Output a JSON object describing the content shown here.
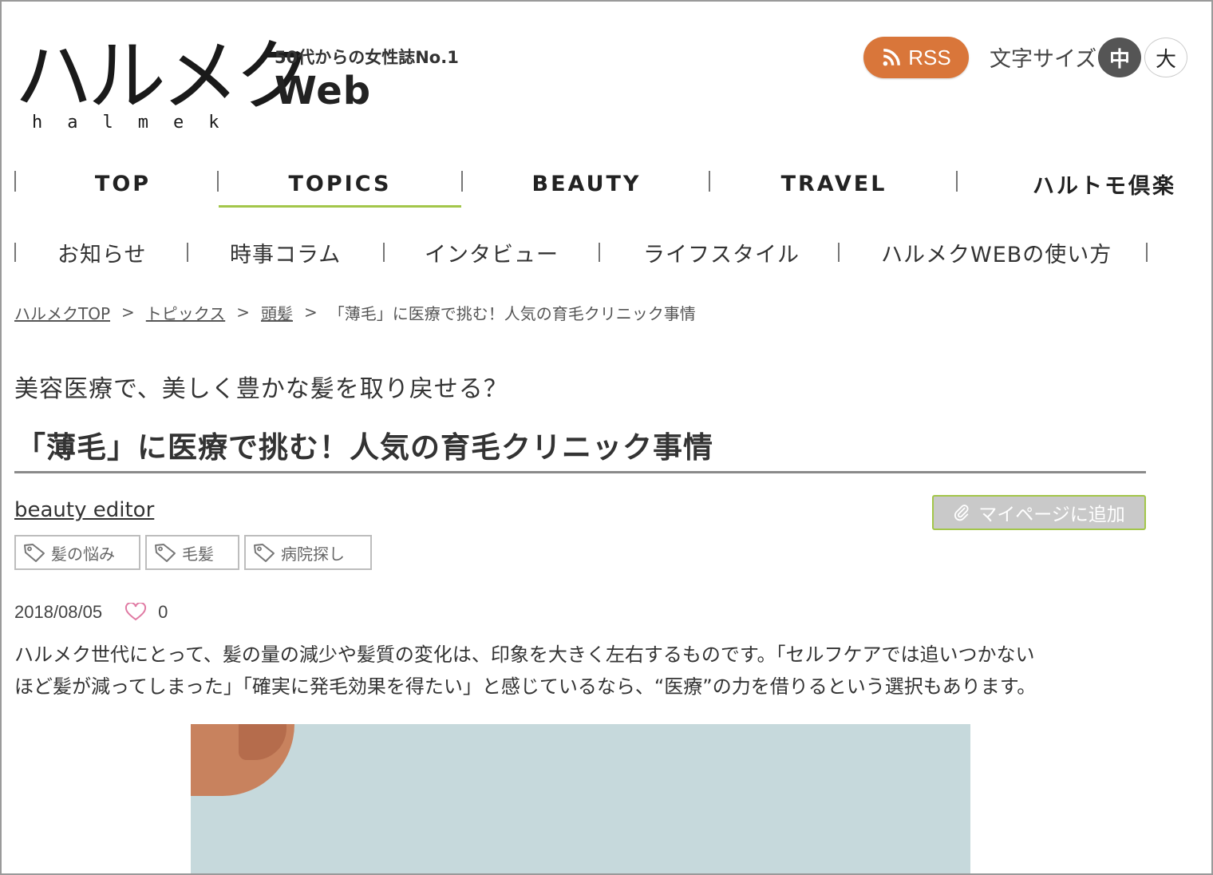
{
  "header": {
    "logo_main": "ハルメク",
    "logo_roman": "halmek",
    "tagline": "50代からの女性誌No.1",
    "logo_web": "Web",
    "rss_label": "RSS",
    "rss_color": "#d9763a",
    "font_size_label": "文字サイズ",
    "font_size_options": [
      {
        "label": "中",
        "selected": true
      },
      {
        "label": "大",
        "selected": false
      }
    ]
  },
  "global_nav": {
    "active_color": "#a3c64a",
    "items": [
      {
        "label": "TOP"
      },
      {
        "label": "TOPICS",
        "active": true
      },
      {
        "label": "BEAUTY"
      },
      {
        "label": "TRAVEL"
      },
      {
        "label": "ハルトモ倶楽"
      }
    ]
  },
  "sub_nav": {
    "items": [
      {
        "label": "お知らせ"
      },
      {
        "label": "時事コラム"
      },
      {
        "label": "インタビュー"
      },
      {
        "label": "ライフスタイル"
      },
      {
        "label": "ハルメクWEBの使い方"
      }
    ]
  },
  "breadcrumb": {
    "items": [
      {
        "label": "ハルメクTOP",
        "link": true
      },
      {
        "label": "トピックス",
        "link": true
      },
      {
        "label": "頭髪",
        "link": true
      },
      {
        "label": "「薄毛」に医療で挑む！人気の育毛クリニック事情",
        "link": false
      }
    ],
    "separator": ">"
  },
  "article": {
    "subtitle": "美容医療で、美しく豊かな髪を取り戻せる？",
    "title": "「薄毛」に医療で挑む！人気の育毛クリニック事情",
    "author": "beauty editor",
    "mypage_button": "マイページに追加",
    "tags": [
      "髪の悩み",
      "毛髪",
      "病院探し"
    ],
    "date": "2018/08/05",
    "like_count": "0",
    "lead_line1": "ハルメク世代にとって、髪の量の減少や髪質の変化は、印象を大きく左右するものです。「セルフケアでは追いつかない",
    "lead_line2": "ほど髪が減ってしまった」「確実に発毛効果を得たい」と感じているなら、“医療”の力を借りるという選択もあります。"
  }
}
